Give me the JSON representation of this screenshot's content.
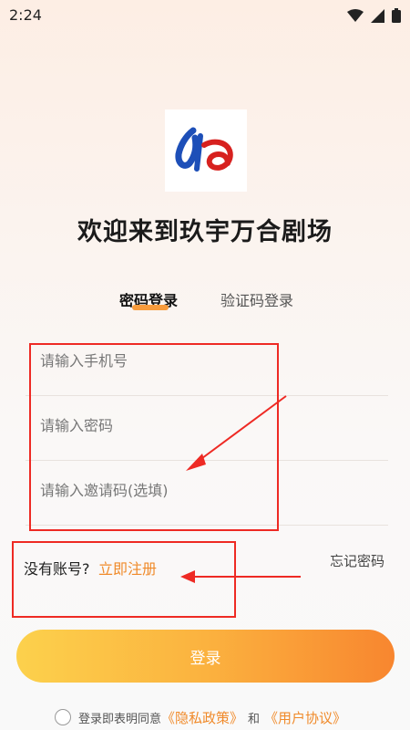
{
  "status": {
    "time": "2:24",
    "icons": [
      "wifi-icon",
      "signal-icon",
      "battery-icon"
    ]
  },
  "app": {
    "logo_icon": "app-logo-icon",
    "welcome": "欢迎来到玖宇万合剧场"
  },
  "tabs": [
    {
      "label": "密码登录",
      "active": true
    },
    {
      "label": "验证码登录",
      "active": false
    }
  ],
  "form": {
    "phone": {
      "value": "",
      "placeholder": "请输入手机号"
    },
    "password": {
      "value": "",
      "placeholder": "请输入密码"
    },
    "invite": {
      "value": "",
      "placeholder": "请输入邀请码(选填)"
    }
  },
  "register": {
    "prompt": "没有账号?",
    "link": "立即注册"
  },
  "forgot": "忘记密码",
  "login": "登录",
  "agreement": {
    "prefix": "登录即表明同意",
    "privacy": "《隐私政策》",
    "and": "和",
    "user": "《用户协议》"
  },
  "colors": {
    "accent": "#f08a2a",
    "annotation": "#ee2a24"
  }
}
